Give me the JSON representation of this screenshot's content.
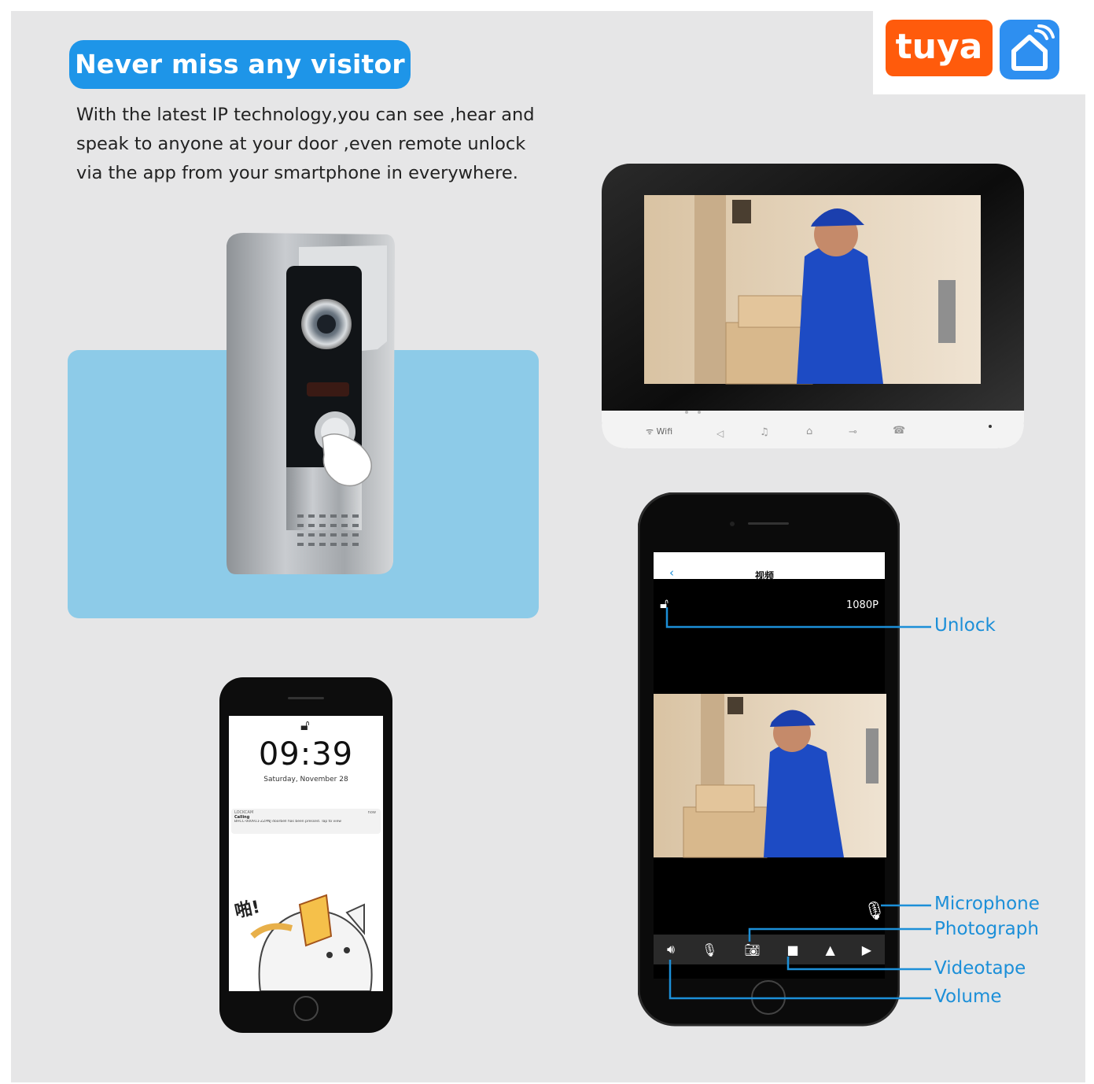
{
  "heading": "Never miss any visitor",
  "description_lines": [
    "With the latest IP technology,you can see ,hear and",
    "speak to anyone at your door ,even remote unlock",
    "via the app from your smartphone in everywhere."
  ],
  "brand": {
    "wordmark": "tuya",
    "icon": "home-icon",
    "color_word": "#ff5b0c",
    "color_icon": "#2e8ff0"
  },
  "monitor": {
    "wifi_label": "Wifi",
    "icons": [
      "speaker-mute-icon",
      "music-icon",
      "bell-icon",
      "key-icon",
      "phone-hangup-icon"
    ]
  },
  "phone_lock": {
    "time": "09:39",
    "date": "Saturday, November 28",
    "notification_app": "LOCKCAM",
    "notification_time": "now",
    "notification_title": "Calling",
    "notification_body": "BHCC-000911-ZZPNJ doorbell has been pressed. Tap to view",
    "sticker_text": "啪!"
  },
  "phone_app": {
    "title": "视频",
    "resolution": "1080P",
    "toolbar_icons": [
      "volume-icon",
      "microphone-icon",
      "camera-icon",
      "video-icon",
      "mirror-icon",
      "play-icon"
    ]
  },
  "callouts": {
    "unlock": "Unlock",
    "microphone": "Microphone",
    "photograph": "Photograph",
    "videotape": "Videotape",
    "volume": "Volume"
  },
  "accent_color": "#1c8fd8"
}
